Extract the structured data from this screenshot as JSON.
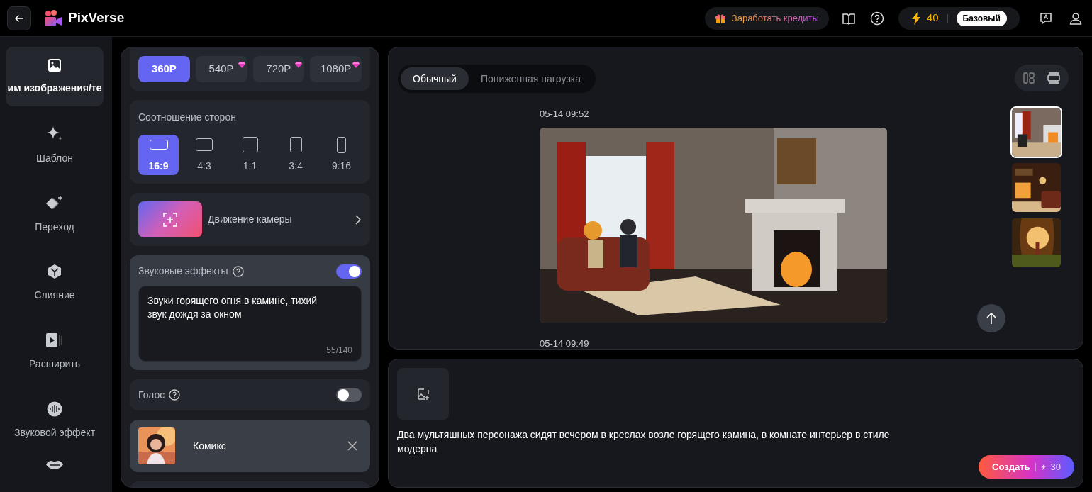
{
  "header": {
    "brand": "PixVerse",
    "earn_button": "Заработать кредиты",
    "credits": "40",
    "plan": "Базовый"
  },
  "sidebar": {
    "items": [
      {
        "label": "им изображения/те",
        "selected": true
      },
      {
        "label": "Шаблон",
        "selected": false
      },
      {
        "label": "Переход",
        "selected": false
      },
      {
        "label": "Слияние",
        "selected": false
      },
      {
        "label": "Расширить",
        "selected": false
      },
      {
        "label": "Звуковой эффект",
        "selected": false
      },
      {
        "selected": false
      }
    ]
  },
  "settings": {
    "resolutions": [
      {
        "label": "360P",
        "selected": true,
        "premium": false
      },
      {
        "label": "540P",
        "selected": false,
        "premium": true
      },
      {
        "label": "720P",
        "selected": false,
        "premium": true
      },
      {
        "label": "1080P",
        "selected": false,
        "premium": true
      }
    ],
    "aspect_title": "Соотношение сторон",
    "aspects": [
      {
        "label": "16:9",
        "selected": true
      },
      {
        "label": "4:3",
        "selected": false
      },
      {
        "label": "1:1",
        "selected": false
      },
      {
        "label": "3:4",
        "selected": false
      },
      {
        "label": "9:16",
        "selected": false
      }
    ],
    "camera_motion": "Движение камеры",
    "sound_effects": {
      "label": "Звуковые эффекты",
      "on": true,
      "value": "Звуки горящего огня в камине, тихий звук дождя за окном",
      "counter": "55/140"
    },
    "voice": {
      "label": "Голос",
      "on": false
    },
    "style": {
      "label": "Комикс"
    }
  },
  "results": {
    "view_modes": [
      {
        "selected": false
      },
      {
        "selected": true
      }
    ],
    "tabs": [
      {
        "label": "Обычный",
        "selected": true
      },
      {
        "label": "Пониженная нагрузка",
        "selected": false
      }
    ],
    "entries": [
      {
        "time": "05-14 09:52",
        "kind": "picture"
      },
      {
        "time": "05-14 09:49"
      }
    ],
    "thumbnails": [
      {
        "selected": true
      },
      {
        "selected": false
      },
      {
        "selected": false
      }
    ]
  },
  "prompt": {
    "text": "Два мультяшных персонажа сидят вечером в креслах возле горящего камина, в комнате интерьер в стиле модерна",
    "create_button": "Создать",
    "cost": "30"
  }
}
